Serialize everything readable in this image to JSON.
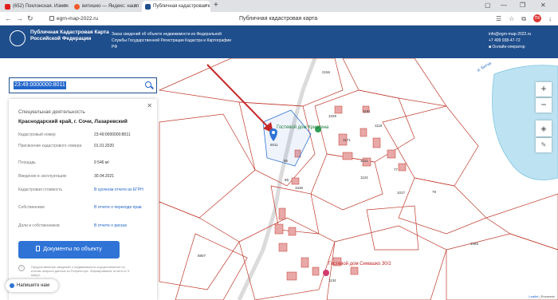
{
  "browser": {
    "tabs": [
      {
        "label": "(652) Поклонская. Измен",
        "favicon_color": "#e02020"
      },
      {
        "label": "витишко — Яндекс: нашл",
        "favicon_color": "#f05a28"
      },
      {
        "label": "Публичная кадастровая к",
        "favicon_color": "#1f4e8c"
      }
    ],
    "new_tab": "+",
    "address": "egrn-map-2022.ru",
    "page_title": "Публичная кадастровая карта",
    "avatar_text": "ПК"
  },
  "header": {
    "logo_text": "Публичная Кадастровая Карта Российской Федерации",
    "description": "Заказ сведений об объекте недвижимости из Федеральной Службы Государственной Регистрации Кадастра и Картографии РФ",
    "email": "info@egrn-map-2022.ru",
    "phone": "+7 499 938-47-72",
    "operator": "Онлайн-оператор"
  },
  "search": {
    "value": "23:49:0000000:8011"
  },
  "panel": {
    "category": "Специальная деятельность",
    "address": "Краснодарский край, г. Сочи, Лазаревский",
    "rows": [
      {
        "label": "Кадастровый номер",
        "value": "23:49:0000000:8011"
      },
      {
        "label": "Присвоение кадастрового номера",
        "value": "01.01.2020"
      },
      {
        "label": "Площадь",
        "value": "9 546 м²"
      },
      {
        "label": "Введение в эксплуатацию",
        "value": "30.04.2021"
      },
      {
        "label": "Кадастровая стоимость",
        "value": "В срочном отчете из ЕГРН"
      },
      {
        "label": "Собственники",
        "value": "В отчете о переходе прав"
      },
      {
        "label": "Доли и собственников",
        "value": "В отчете о рисках"
      }
    ],
    "docs_button": "Документы по объекту",
    "disclaimer": "Предоставление сведений о недвижимости осуществляется по итогам запроса данных из Росреестра. Формирование отчета от 5 минут."
  },
  "chat": {
    "label": "Напишите нам"
  },
  "map": {
    "labels": {
      "guesthouse": "Гостевой дом Кристина",
      "guesthouse2": "Гостевой дом Семашко 30/2",
      "river": "р. Битха",
      "n2156": "2156",
      "n1029": "1029",
      "n8011": "8011",
      "n1017": "1017",
      "n78": "78",
      "n1065": "1065",
      "n8807": "8807",
      "n1134": "1134",
      "n1121": "1121",
      "n1124": "1124",
      "n77": "77",
      "n95": "95",
      "n1536": "1536",
      "n88": "88",
      "n1181": "1181",
      "n1118": "1118",
      "n1171": "1171"
    },
    "attribution_leaflet": "Leaflet",
    "attribution_rest": "| Rosreestr"
  }
}
